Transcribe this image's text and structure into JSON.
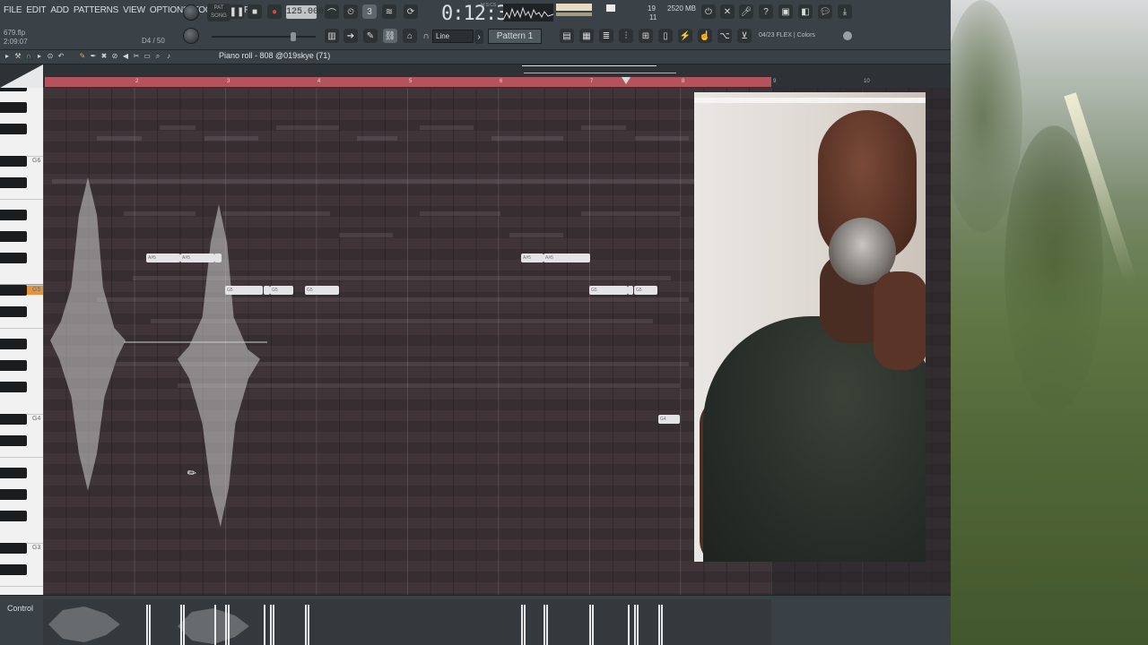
{
  "menu": [
    "FILE",
    "EDIT",
    "ADD",
    "PATTERNS",
    "VIEW",
    "OPTIONS",
    "TOOLS",
    "HELP"
  ],
  "project": {
    "file": "679.flp",
    "time": "2:09:07",
    "position": "D4 / 50"
  },
  "transport": {
    "pat_label": "PAT",
    "song_label": "SONG",
    "tempo": "125.000",
    "time": "0:12:31",
    "time_unit": "M:S:CS"
  },
  "monitor": {
    "cpu": "19",
    "memory": "2520 MB",
    "polyphony": "11"
  },
  "toolbar": {
    "snap": "Line",
    "pattern": "Pattern 1",
    "browser_info": "04/23  FLEX | Colors"
  },
  "piano_roll": {
    "title": "Piano roll - 808 @019skye (71)"
  },
  "timeline": {
    "bars": [
      "2",
      "3",
      "4",
      "5",
      "6",
      "7",
      "8",
      "9",
      "10"
    ]
  },
  "keyboard": {
    "labels": [
      "G6",
      "G5",
      "G4",
      "G3"
    ]
  },
  "notes": [
    "A#5",
    "A#5",
    "G5",
    "G5",
    "G5",
    "A#5",
    "A#5",
    "G5",
    "G5",
    "G4"
  ],
  "control": {
    "label": "Control"
  },
  "colors": {
    "loop": "#b4535b",
    "highlight_key": "#e9923b",
    "grid": "#3d3337"
  }
}
